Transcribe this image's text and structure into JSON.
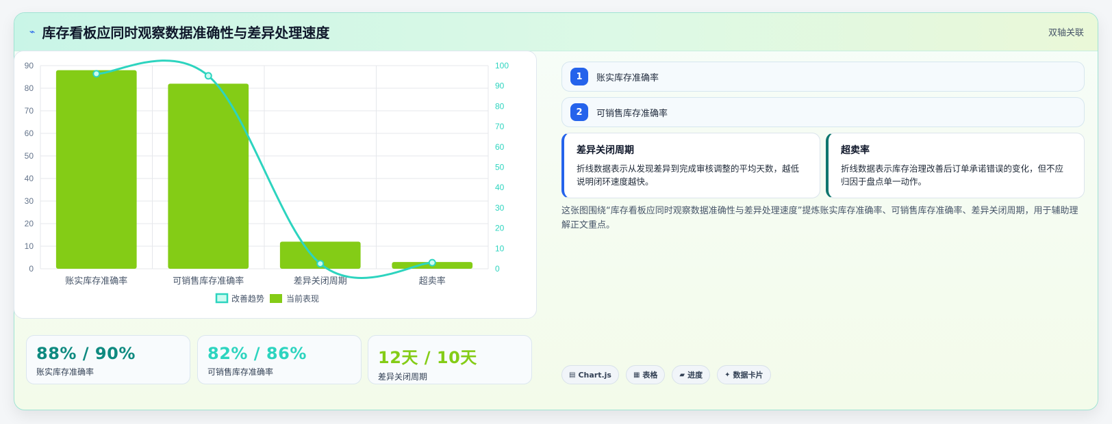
{
  "header": {
    "title": "库存看板应同时观察数据准确性与差异处理速度",
    "badge": "双轴关联",
    "icon": "bolt-icon"
  },
  "chart_data": {
    "type": "bar",
    "categories": [
      "账实库存准确率",
      "可销售库存准确率",
      "差异关闭周期",
      "超卖率"
    ],
    "series": [
      {
        "name": "当前表现",
        "type": "bar",
        "axis": "left",
        "color": "#84cc16",
        "values": [
          88,
          82,
          12,
          3
        ]
      },
      {
        "name": "改善趋势",
        "type": "line",
        "axis": "right",
        "color": "#2dd4bf",
        "values": [
          96,
          95,
          2.5,
          3
        ]
      }
    ],
    "y_left": {
      "min": 0,
      "max": 90,
      "ticks": [
        0,
        10,
        20,
        30,
        40,
        50,
        60,
        70,
        80,
        90
      ]
    },
    "y_right": {
      "min": 0,
      "max": 100,
      "ticks": [
        0,
        10,
        20,
        30,
        40,
        50,
        60,
        70,
        80,
        90,
        100
      ]
    },
    "legend": [
      "改善趋势",
      "当前表现"
    ],
    "legend_position": "bottom",
    "grid": true
  },
  "kpis": [
    {
      "value": "88% / 90%",
      "label": "账实库存准确率",
      "color": "#0f8a80"
    },
    {
      "value": "82% / 86%",
      "label": "可销售库存准确率",
      "color": "#2dd4bf"
    },
    {
      "value": "12天 / 10天",
      "label": "差异关闭周期",
      "color": "#84cc16"
    }
  ],
  "list": [
    {
      "num": "1",
      "label": "账实库存准确率"
    },
    {
      "num": "2",
      "label": "可销售库存准确率"
    }
  ],
  "notes": [
    {
      "title": "差异关闭周期",
      "text": "折线数据表示从发现差异到完成审核调整的平均天数，越低说明闭环速度越快。",
      "accent": "#2563eb"
    },
    {
      "title": "超卖率",
      "text": "折线数据表示库存治理改善后订单承诺错误的变化，但不应归因于盘点单一动作。",
      "accent": "#0f766e"
    }
  ],
  "description": "这张图围绕“库存看板应同时观察数据准确性与差异处理速度”提炼账实库存准确率、可销售库存准确率、差异关闭周期，用于辅助理解正文重点。",
  "tags": [
    {
      "icon": "▤",
      "label": "Chart.js"
    },
    {
      "icon": "▦",
      "label": "表格"
    },
    {
      "icon": "▰",
      "label": "进度"
    },
    {
      "icon": "✦",
      "label": "数据卡片"
    }
  ]
}
